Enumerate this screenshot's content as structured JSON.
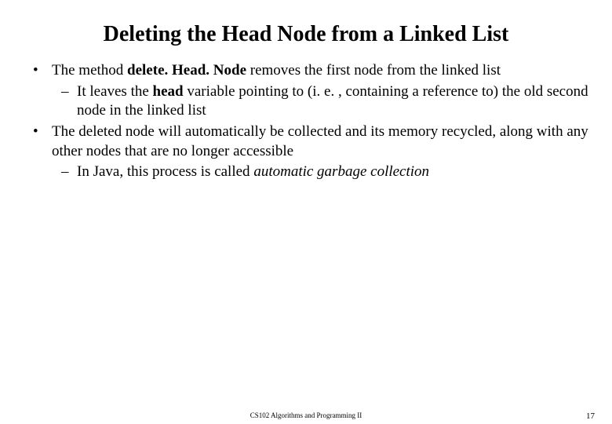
{
  "title": "Deleting the Head Node from a Linked List",
  "bullets": [
    {
      "pre": "The method ",
      "bold": "delete. Head. Node",
      "post": " removes the first node from the linked list",
      "sub": [
        {
          "pre": "It leaves the ",
          "bold": "head",
          "post": " variable pointing to (i. e. , containing a reference to) the old second node in the linked list"
        }
      ]
    },
    {
      "pre": "The deleted node will automatically be collected and its memory recycled, along with any other nodes that are no longer accessible",
      "bold": "",
      "post": "",
      "sub": [
        {
          "pre": "In Java, this process is called ",
          "italic": "automatic garbage collection",
          "post": ""
        }
      ]
    }
  ],
  "footer": {
    "center": "CS102 Algorithms and Programming II",
    "right": "17"
  }
}
